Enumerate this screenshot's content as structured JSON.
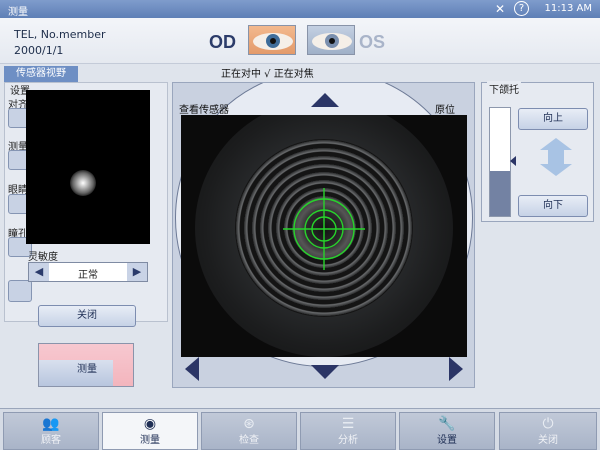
{
  "titlebar": {
    "title": "测量",
    "close": "✕",
    "help": "?",
    "time": "11:13 AM"
  },
  "patient": {
    "name": "TEL, No.member",
    "date": "2000/1/1"
  },
  "eyes": {
    "od": "OD",
    "os": "OS"
  },
  "status_text": "正在对中 √ 正在对焦",
  "left": {
    "tab": "传感器视野",
    "labels": [
      "设置",
      "对齐",
      "测量",
      "眼睛",
      "瞳孔"
    ],
    "sensitivity_label": "灵敏度",
    "sensitivity_value": "正常",
    "close_button": "关闭",
    "measure_button": "测量"
  },
  "center": {
    "view_sensor": "查看传感器",
    "origin": "原位"
  },
  "right": {
    "title": "下颌托",
    "up": "向上",
    "down": "向下",
    "slider_level": 0.42
  },
  "nav": [
    {
      "label": "顾客",
      "icon": "people-icon"
    },
    {
      "label": "测量",
      "icon": "eye-icon"
    },
    {
      "label": "检查",
      "icon": "check-icon"
    },
    {
      "label": "分析",
      "icon": "analysis-icon"
    },
    {
      "label": "设置",
      "icon": "wrench-icon"
    },
    {
      "label": "关闭",
      "icon": "power-icon"
    }
  ],
  "colors": {
    "accent": "#5e7fb6",
    "crosshair": "#27d42b",
    "arrow": "#2b3566"
  }
}
